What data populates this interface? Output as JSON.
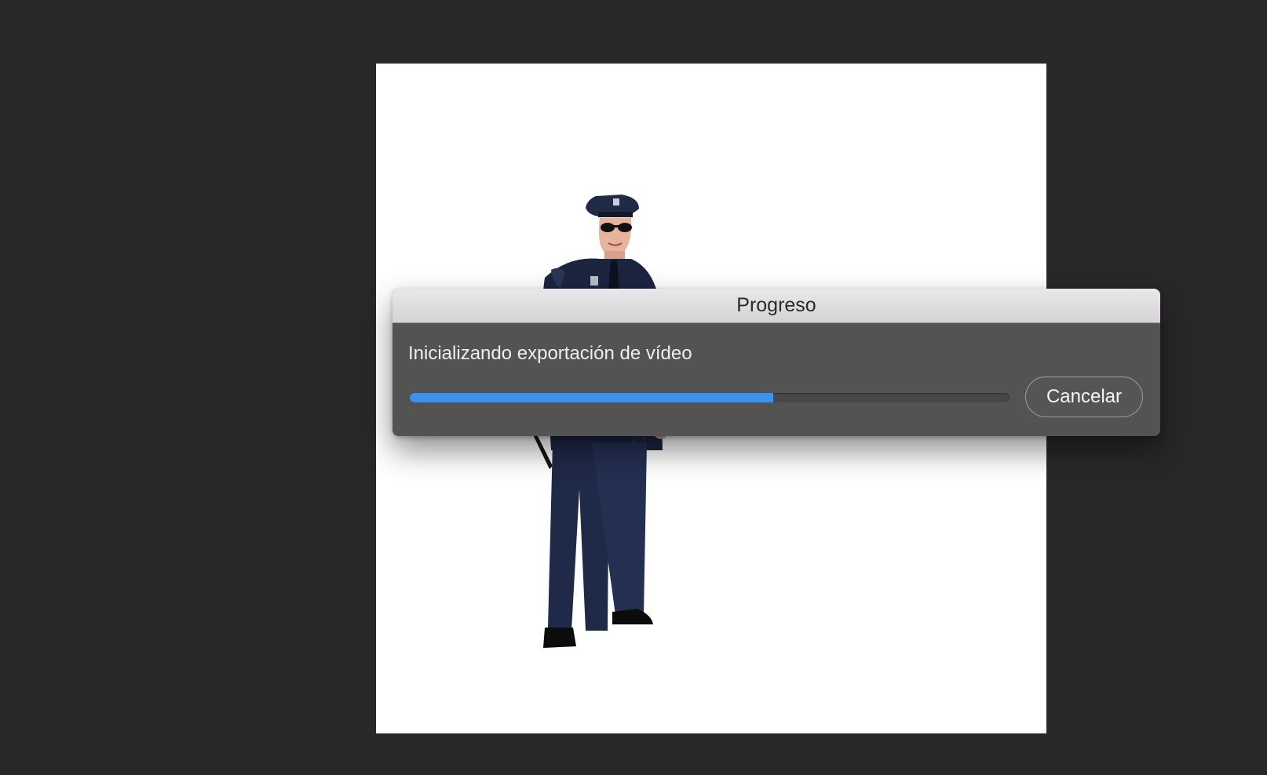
{
  "dialog": {
    "title": "Progreso",
    "status": "Inicializando exportación de vídeo",
    "progress": 0.606,
    "cancel_label": "Cancelar"
  },
  "canvas": {
    "image": "police-officer-figure"
  },
  "colors": {
    "workspace_bg": "#282828",
    "dialog_bg": "#535353",
    "titlebar_bg": "#e0dee0",
    "progress_fill": "#3d92ee",
    "progress_track": "#474747"
  }
}
